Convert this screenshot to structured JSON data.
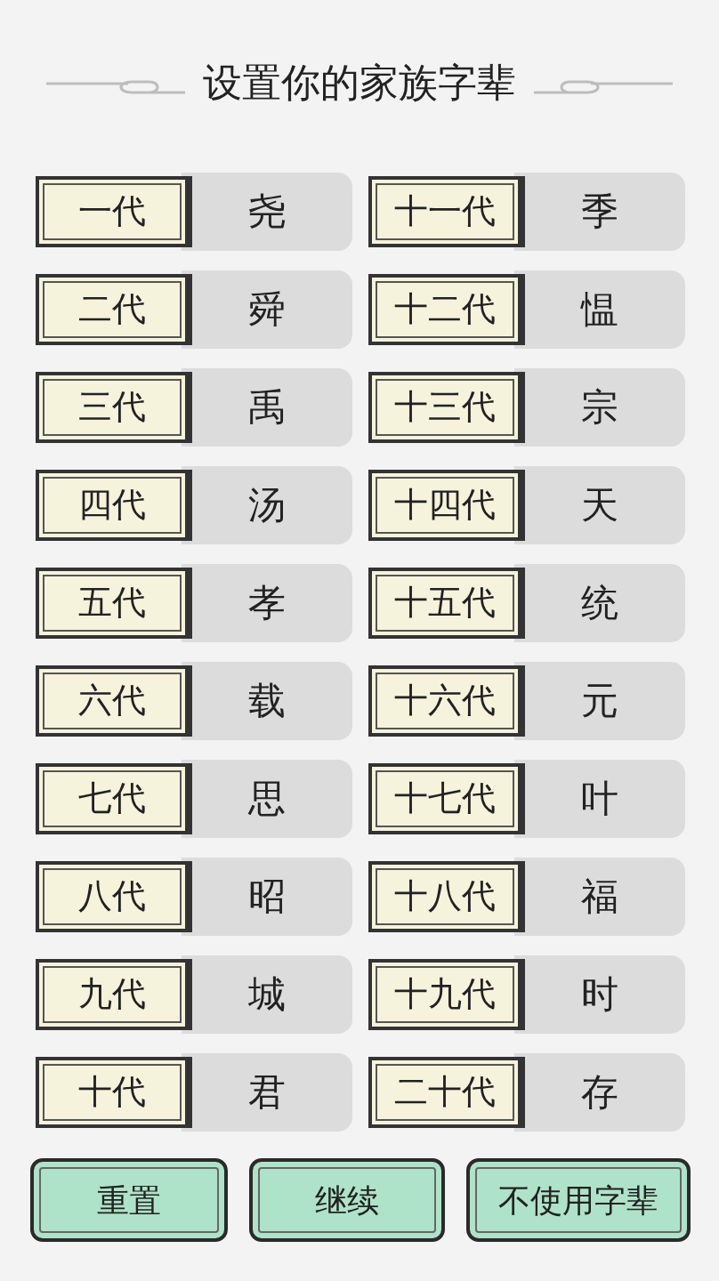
{
  "title": "设置你的家族字辈",
  "generations": [
    {
      "label": "一代",
      "name": "尧"
    },
    {
      "label": "二代",
      "name": "舜"
    },
    {
      "label": "三代",
      "name": "禹"
    },
    {
      "label": "四代",
      "name": "汤"
    },
    {
      "label": "五代",
      "name": "孝"
    },
    {
      "label": "六代",
      "name": "载"
    },
    {
      "label": "七代",
      "name": "思"
    },
    {
      "label": "八代",
      "name": "昭"
    },
    {
      "label": "九代",
      "name": "城"
    },
    {
      "label": "十代",
      "name": "君"
    },
    {
      "label": "十一代",
      "name": "季"
    },
    {
      "label": "十二代",
      "name": "愠"
    },
    {
      "label": "十三代",
      "name": "宗"
    },
    {
      "label": "十四代",
      "name": "天"
    },
    {
      "label": "十五代",
      "name": "统"
    },
    {
      "label": "十六代",
      "name": "元"
    },
    {
      "label": "十七代",
      "name": "叶"
    },
    {
      "label": "十八代",
      "name": "福"
    },
    {
      "label": "十九代",
      "name": "时"
    },
    {
      "label": "二十代",
      "name": "存"
    }
  ],
  "buttons": [
    "重置",
    "继续",
    "不使用字辈"
  ]
}
